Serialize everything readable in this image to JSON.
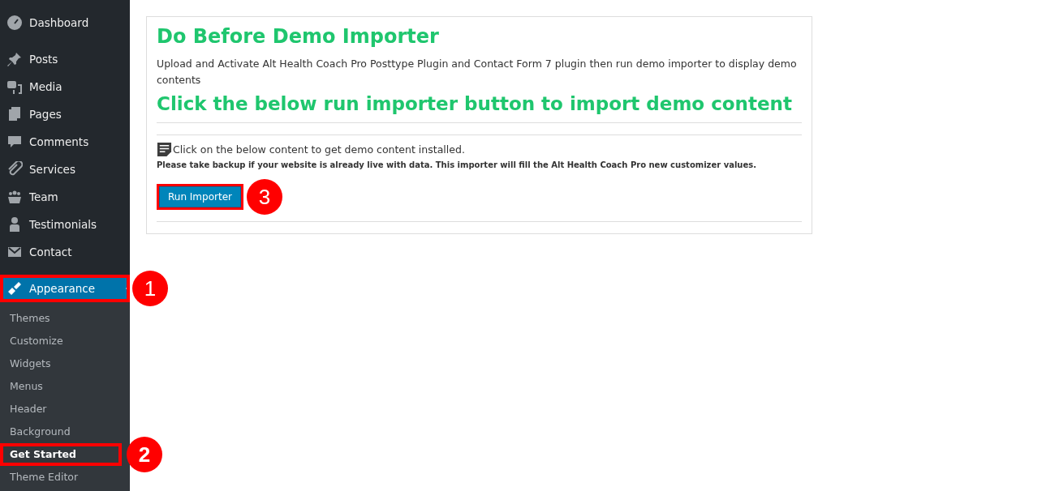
{
  "sidebar": {
    "items": [
      {
        "label": "Dashboard",
        "selected": false,
        "highlighted": false
      },
      {
        "label": "Posts",
        "selected": false,
        "highlighted": false
      },
      {
        "label": "Media",
        "selected": false,
        "highlighted": false
      },
      {
        "label": "Pages",
        "selected": false,
        "highlighted": false
      },
      {
        "label": "Comments",
        "selected": false,
        "highlighted": false
      },
      {
        "label": "Services",
        "selected": false,
        "highlighted": false
      },
      {
        "label": "Team",
        "selected": false,
        "highlighted": false
      },
      {
        "label": "Testimonials",
        "selected": false,
        "highlighted": false
      },
      {
        "label": "Contact",
        "selected": false,
        "highlighted": false
      },
      {
        "label": "Appearance",
        "selected": true,
        "highlighted": true,
        "callout": "1"
      }
    ],
    "submenu": [
      {
        "label": "Themes",
        "selected": false,
        "highlighted": false
      },
      {
        "label": "Customize",
        "selected": false,
        "highlighted": false
      },
      {
        "label": "Widgets",
        "selected": false,
        "highlighted": false
      },
      {
        "label": "Menus",
        "selected": false,
        "highlighted": false
      },
      {
        "label": "Header",
        "selected": false,
        "highlighted": false
      },
      {
        "label": "Background",
        "selected": false,
        "highlighted": false
      },
      {
        "label": "Get Started",
        "selected": true,
        "highlighted": true,
        "callout": "2"
      },
      {
        "label": "Theme Editor",
        "selected": false,
        "highlighted": false
      }
    ]
  },
  "card": {
    "heading": "Do Before Demo Importer",
    "intro": "Upload and Activate Alt Health Coach Pro Posttype Plugin and Contact Form 7 plugin then run demo importer to display demo contents",
    "subheading": "Click the below run importer button to import demo content",
    "note": "Click on the below content to get demo content installed.",
    "warning": "Please take backup if your website is already live with data. This importer will fill the Alt Health Coach Pro new customizer values.",
    "button": {
      "label": "Run Importer",
      "highlighted": true,
      "callout": "3"
    }
  }
}
